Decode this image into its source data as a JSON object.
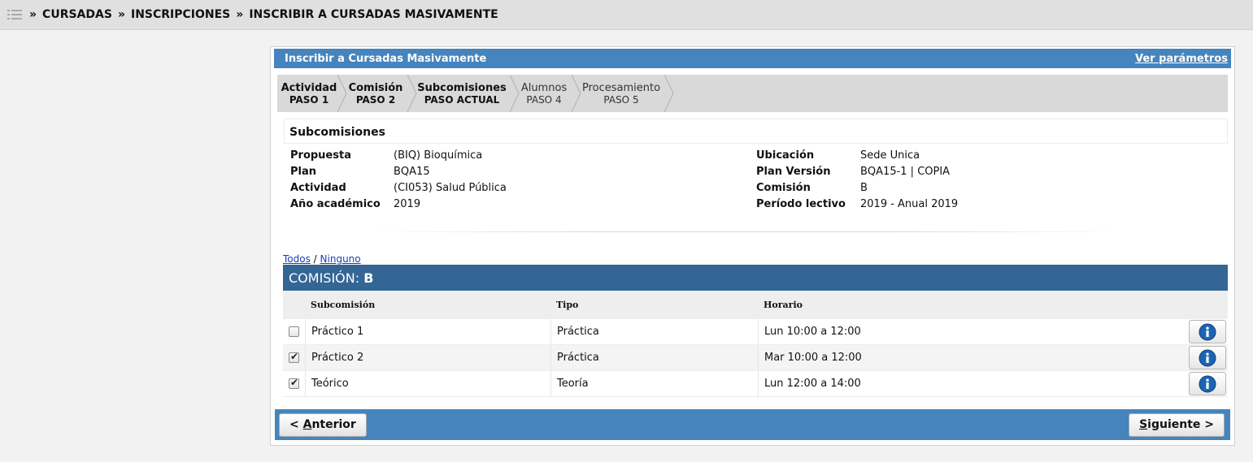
{
  "breadcrumb": {
    "separator": "»",
    "items": [
      "CURSADAS",
      "INSCRIPCIONES",
      "INSCRIBIR A CURSADAS MASIVAMENTE"
    ]
  },
  "panel": {
    "title": "Inscribir a Cursadas Masivamente",
    "params_link": "Ver parámetros"
  },
  "steps": [
    {
      "title": "Actividad",
      "sub": "PASO 1",
      "state": "done"
    },
    {
      "title": "Comisión",
      "sub": "PASO 2",
      "state": "done"
    },
    {
      "title": "Subcomisiones",
      "sub": "PASO ACTUAL",
      "state": "current"
    },
    {
      "title": "Alumnos",
      "sub": "PASO 4",
      "state": "todo"
    },
    {
      "title": "Procesamiento",
      "sub": "PASO 5",
      "state": "todo"
    }
  ],
  "section_title": "Subcomisiones",
  "info_left": [
    {
      "label": "Propuesta",
      "value": "(BIQ) Bioquímica"
    },
    {
      "label": "Plan",
      "value": "BQA15"
    },
    {
      "label": "Actividad",
      "value": "(CI053) Salud Pública"
    },
    {
      "label": "Año académico",
      "value": "2019"
    }
  ],
  "info_right": [
    {
      "label": "Ubicación",
      "value": "Sede Unica"
    },
    {
      "label": "Plan Versión",
      "value": "BQA15-1 | COPIA"
    },
    {
      "label": "Comisión",
      "value": "B"
    },
    {
      "label": "Período lectivo",
      "value": "2019 - Anual 2019"
    }
  ],
  "select_all": "Todos",
  "select_sep": "/",
  "select_none": "Ninguno",
  "comision": {
    "label": "COMISIÓN:",
    "value": "B"
  },
  "table": {
    "headers": {
      "subcomision": "Subcomisión",
      "tipo": "Tipo",
      "horario": "Horario"
    },
    "rows": [
      {
        "checked": false,
        "subcomision": "Práctico 1",
        "tipo": "Práctica",
        "horario": "Lun 10:00 a 12:00"
      },
      {
        "checked": true,
        "subcomision": "Práctico 2",
        "tipo": "Práctica",
        "horario": "Mar 10:00 a 12:00"
      },
      {
        "checked": true,
        "subcomision": "Teórico",
        "tipo": "Teoría",
        "horario": "Lun 12:00 a 14:00"
      }
    ]
  },
  "buttons": {
    "prev_prefix": "< ",
    "prev_accel": "A",
    "prev_rest": "nterior",
    "next_accel": "S",
    "next_rest": "iguiente >"
  },
  "colors": {
    "accent": "#4684bd",
    "comision_bar": "#336695",
    "info_icon": "#1c64b4"
  }
}
